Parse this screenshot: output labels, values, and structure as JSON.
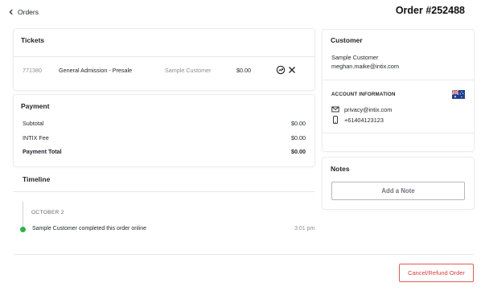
{
  "header": {
    "back_label": "Orders",
    "order_title": "Order #252488"
  },
  "tickets": {
    "title": "Tickets",
    "rows": [
      {
        "id": "771380",
        "name": "General Admission - Presale",
        "customer": "Sample Customer",
        "price": "$0.00"
      }
    ]
  },
  "payment": {
    "title": "Payment",
    "rows": [
      {
        "label": "Subtotal",
        "value": "$0.00"
      },
      {
        "label": "INTIX Fee",
        "value": "$0.00"
      },
      {
        "label": "Payment Total",
        "value": "$0.00"
      }
    ]
  },
  "timeline": {
    "title": "Timeline",
    "date": "OCTOBER 2",
    "events": [
      {
        "text": "Sample Customer completed this order online",
        "time": "3:01 pm",
        "status_color": "#2bb24c"
      }
    ]
  },
  "customer": {
    "title": "Customer",
    "name": "Sample Customer",
    "email": "meghan.maike@intix.com",
    "account_title": "ACCOUNT INFORMATION",
    "flag": "australia-flag",
    "contact_email": "privacy@intix.com",
    "phone": "+61404123123"
  },
  "notes": {
    "title": "Notes",
    "add_label": "Add a Note"
  },
  "footer": {
    "refund_label": "Cancel/Refund Order"
  },
  "colors": {
    "danger": "#d63c3c",
    "success": "#2bb24c"
  }
}
